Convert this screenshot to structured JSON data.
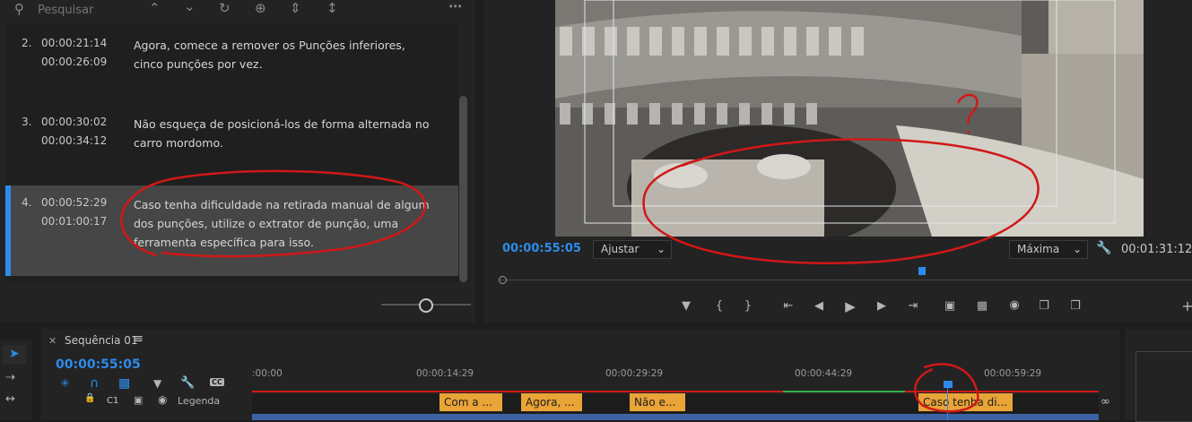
{
  "captions_panel": {
    "search_placeholder": "Pesquisar",
    "icons": [
      "chevron-up-icon",
      "chevron-down-icon",
      "refresh-icon",
      "add-icon",
      "split-icon",
      "merge-icon",
      "more-icon"
    ],
    "items": [
      {
        "num": "2.",
        "in": "00:00:21:14",
        "out": "00:00:26:09",
        "text": "Agora, comece a remover os Punções inferiores, cinco punções por vez."
      },
      {
        "num": "3.",
        "in": "00:00:30:02",
        "out": "00:00:34:12",
        "text": "Não esqueça de posicioná-los de forma alternada no carro mordomo."
      },
      {
        "num": "4.",
        "in": "00:00:52:29",
        "out": "00:01:00:17",
        "text": "Caso tenha dificuldade na retirada manual de algum dos punções, utilize o extrator de punção, uma ferramenta específica para isso.",
        "selected": true
      }
    ]
  },
  "program_monitor": {
    "current_time": "00:00:55:05",
    "fit_label": "Ajustar",
    "quality_label": "Máxima",
    "duration": "00:01:31:12",
    "playhead_fraction": 0.61
  },
  "timeline": {
    "sequence_tab": "Sequência 01",
    "current_time": "00:00:55:05",
    "ruler": [
      ":00:00",
      "00:00:14:29",
      "00:00:29:29",
      "00:00:44:29",
      "00:00:59:29"
    ],
    "track_name": "C1",
    "track_label": "Legenda",
    "clips": [
      "Com a ...",
      "Agora, ...",
      "Não e...",
      "Caso tenha di..."
    ]
  },
  "colors": {
    "accent": "#2d8ceb",
    "clip": "#e9a438",
    "annotation": "#d01818"
  }
}
